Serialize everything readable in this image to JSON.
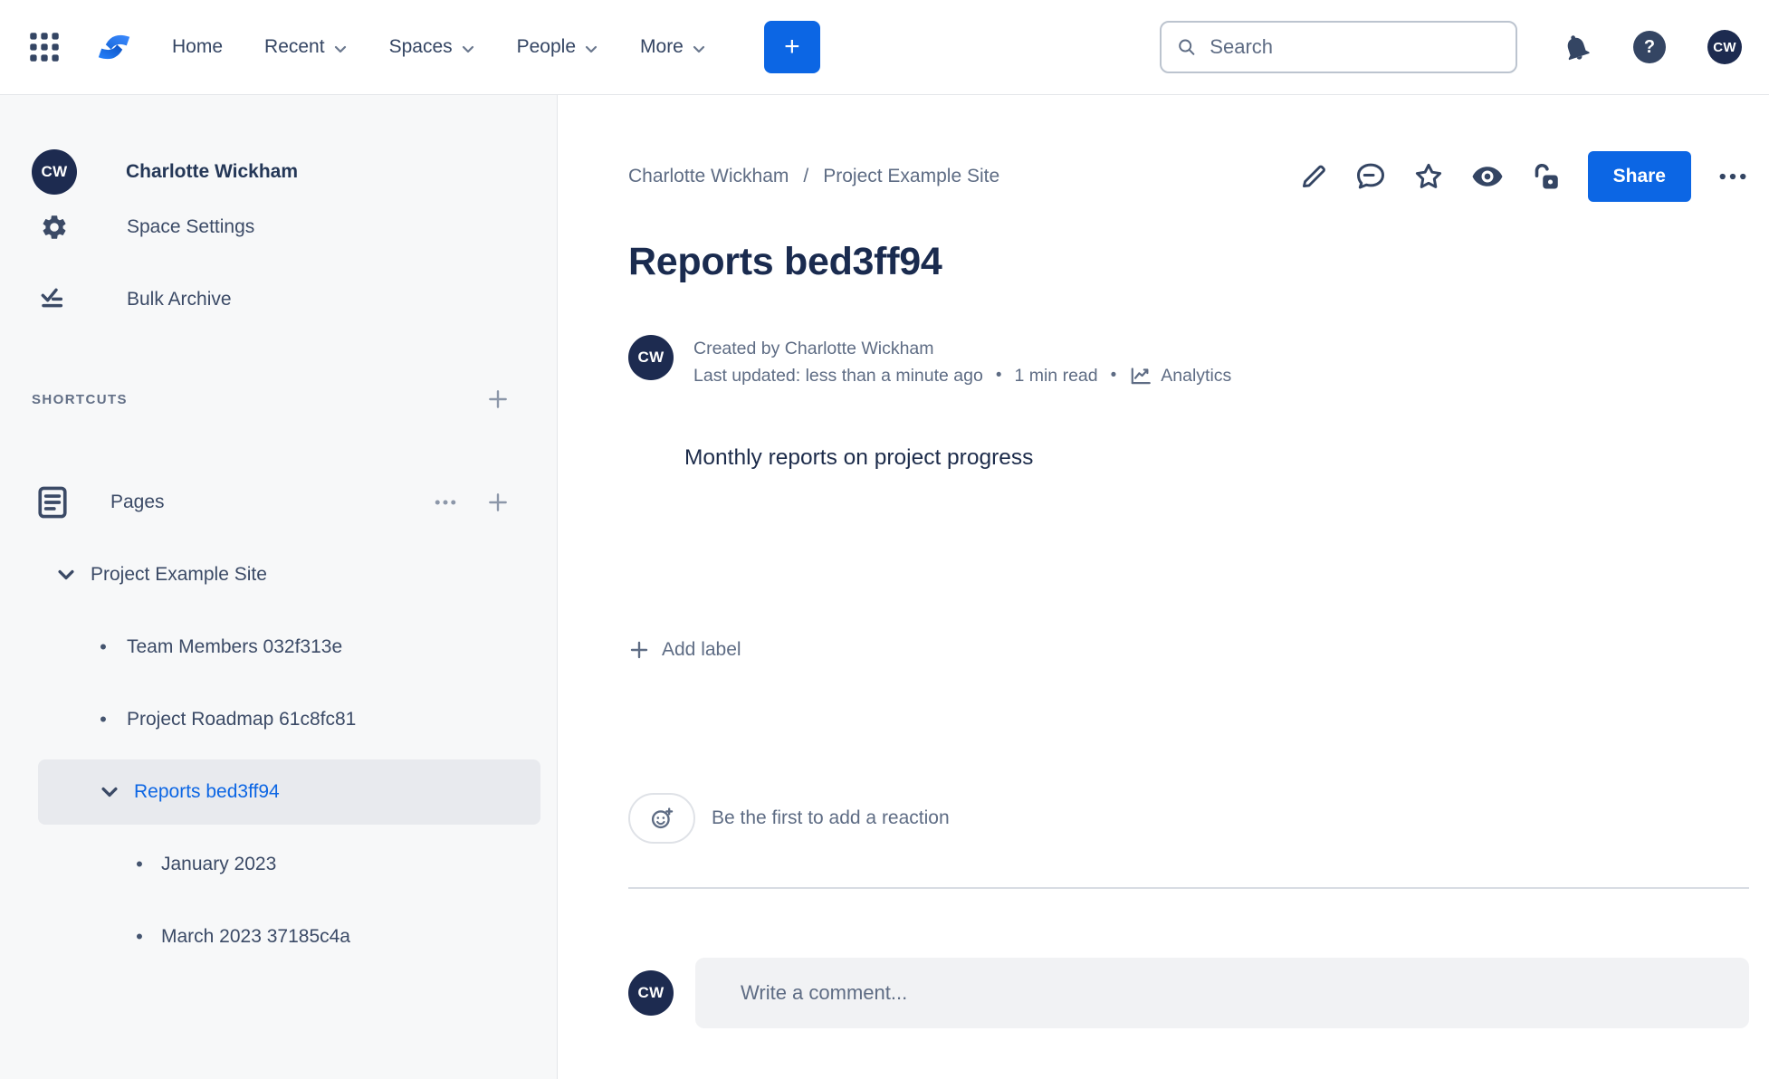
{
  "topnav": {
    "nav_items": [
      {
        "label": "Home",
        "has_dropdown": false
      },
      {
        "label": "Recent",
        "has_dropdown": true
      },
      {
        "label": "Spaces",
        "has_dropdown": true
      },
      {
        "label": "People",
        "has_dropdown": true
      },
      {
        "label": "More",
        "has_dropdown": true
      }
    ],
    "create_label": "+",
    "search_placeholder": "Search",
    "help_glyph": "?",
    "avatar_initials": "CW"
  },
  "sidebar": {
    "avatar_initials": "CW",
    "space_name": "Charlotte Wickham",
    "items": [
      {
        "label": "Space Settings",
        "icon": "gear-icon"
      },
      {
        "label": "Bulk Archive",
        "icon": "bulk-archive-icon"
      }
    ],
    "shortcuts_heading": "SHORTCUTS",
    "pages_label": "Pages",
    "tree": [
      {
        "label": "Project Example Site",
        "level": 1,
        "marker": "chevron",
        "selected": false
      },
      {
        "label": "Team Members 032f313e",
        "level": 2,
        "marker": "bullet",
        "selected": false
      },
      {
        "label": "Project Roadmap 61c8fc81",
        "level": 2,
        "marker": "bullet",
        "selected": false
      },
      {
        "label": "Reports bed3ff94",
        "level": 2,
        "marker": "chevron",
        "selected": true
      },
      {
        "label": "January 2023",
        "level": 3,
        "marker": "bullet",
        "selected": false
      },
      {
        "label": "March 2023 37185c4a",
        "level": 3,
        "marker": "bullet",
        "selected": false
      }
    ],
    "bullet_glyph": "•"
  },
  "content": {
    "breadcrumb": {
      "0": "Charlotte Wickham",
      "separator": "/",
      "1": "Project Example Site"
    },
    "share_label": "Share",
    "title": "Reports bed3ff94",
    "byline": {
      "avatar_initials": "CW",
      "created": "Created by Charlotte Wickham",
      "updated": "Last updated: less than a minute ago",
      "sep": "•",
      "read_time": "1 min read",
      "analytics_label": "Analytics"
    },
    "body_text": "Monthly reports on project progress",
    "add_label_text": "Add label",
    "reaction_prompt": "Be the first to add a reaction",
    "comment_avatar_initials": "CW",
    "comment_placeholder": "Write a comment..."
  },
  "colors": {
    "accent_blue": "#0C66E4",
    "navy_text": "#1A2B4F",
    "gray_text": "#5E6C84",
    "sidebar_bg": "#F7F8F9",
    "selected_row_bg": "#E8EAEE",
    "avatar_bg": "#1D2B50"
  }
}
